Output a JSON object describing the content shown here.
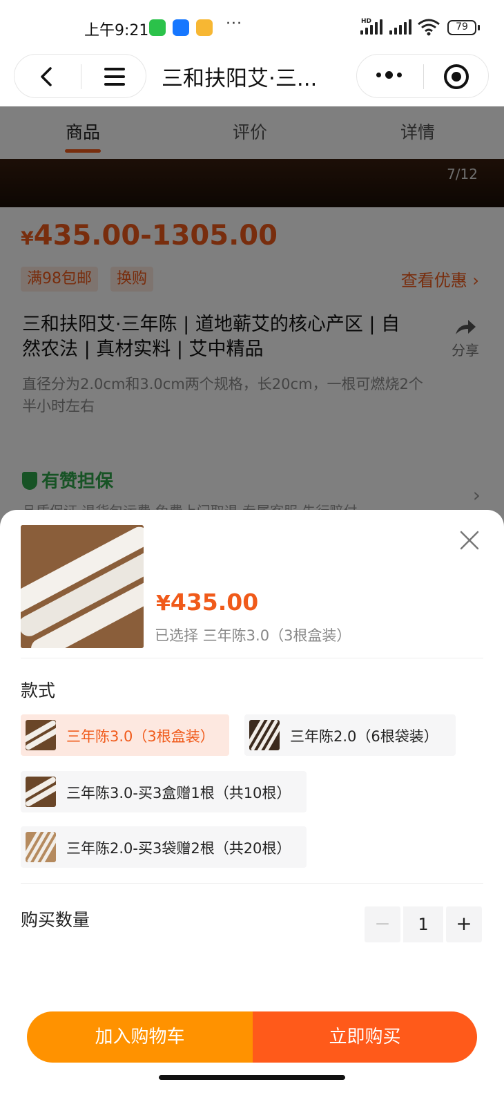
{
  "status_bar": {
    "time": "上午9:21",
    "more": "···",
    "battery": "79",
    "hd": "HD"
  },
  "navbar": {
    "title": "三和扶阳艾·三..."
  },
  "tabs": [
    {
      "label": "商品",
      "active": true
    },
    {
      "label": "评价",
      "active": false
    },
    {
      "label": "详情",
      "active": false
    }
  ],
  "gallery": {
    "page_indicator": "7/12"
  },
  "product": {
    "currency": "¥",
    "price_range": "435.00-1305.00",
    "tags": [
      "满98包邮",
      "换购"
    ],
    "see_offer": "查看优惠 ›",
    "title": "三和扶阳艾·三年陈 | 道地蕲艾的核心产区 | 自然农法 | 真材实料 | 艾中精品",
    "share_label": "分享",
    "description": "直径分为2.0cm和3.0cm两个规格，长20cm，一根可燃烧2个半小时左右",
    "guarantee_title": "有赞担保",
    "guarantee_sub": "品质保证 退货包运费 免费上门取退 专属客服 先行赔付"
  },
  "sheet": {
    "currency": "¥",
    "price": "435.00",
    "selected_text": "已选择 三年陈3.0（3根盒装）",
    "style_label": "款式",
    "options": [
      {
        "label": "三年陈3.0（3根盒装）",
        "selected": true
      },
      {
        "label": "三年陈2.0（6根袋装）",
        "selected": false
      },
      {
        "label": "三年陈3.0-买3盒赠1根（共10根）",
        "selected": false
      },
      {
        "label": "三年陈2.0-买3袋赠2根（共20根）",
        "selected": false
      }
    ],
    "quantity_label": "购买数量",
    "quantity": "1",
    "minus": "−",
    "plus": "+",
    "add_to_cart": "加入购物车",
    "buy_now": "立即购买"
  },
  "colors": {
    "accent": "#f05a1a",
    "cart": "#ff9200",
    "buy": "#ff5a1a",
    "guarantee": "#2fa64a"
  }
}
